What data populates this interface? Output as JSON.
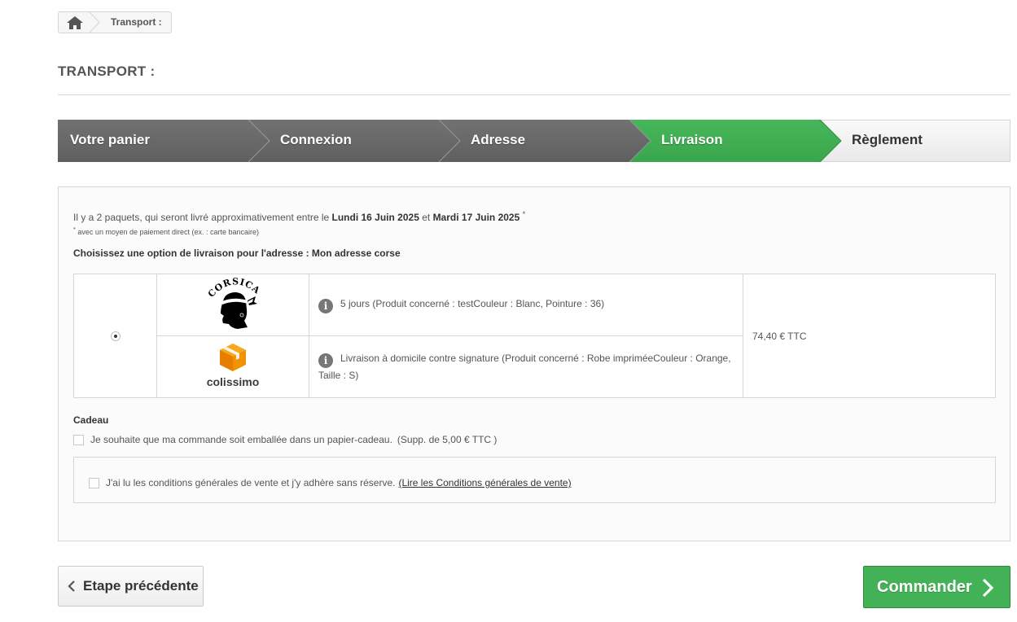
{
  "breadcrumb": {
    "home_icon": "home-icon",
    "current": "Transport :"
  },
  "page": {
    "title": "TRANSPORT :"
  },
  "steps": [
    {
      "label": "Votre panier",
      "state": "done"
    },
    {
      "label": "Connexion",
      "state": "done"
    },
    {
      "label": "Adresse",
      "state": "done"
    },
    {
      "label": "Livraison",
      "state": "current"
    },
    {
      "label": "Règlement",
      "state": "todo"
    }
  ],
  "colors": {
    "step_done": "#666666",
    "step_current": "#43b155",
    "step_todo": "#f4f4f4",
    "accent_green": "#43b155"
  },
  "delivery": {
    "intro": "Il y a 2 paquets, qui seront livré approximativement entre le ",
    "date_start": "Lundi 16 Juin 2025",
    "and": " et ",
    "date_end": "Mardi 17 Juin 2025",
    "asterisk": "*",
    "note_asterisk": "*",
    "note": " avec un moyen de paiement direct (ex. : carte bancaire)",
    "choose_label": "Choisissez une option de livraison pour l'adresse : Mon adresse corse"
  },
  "option": {
    "selected": true,
    "price": "74,40 € TTC",
    "carriers": [
      {
        "logo": "corsica-logo",
        "logo_text": "CORSICA",
        "description": "5 jours (Produit concerné : testCouleur : Blanc, Pointure : 36)"
      },
      {
        "logo": "colissimo-logo",
        "logo_text": "colissimo",
        "description": "Livraison à domicile contre signature (Produit concerné : Robe impriméeCouleur : Orange, Taille : S)"
      }
    ]
  },
  "gift": {
    "title": "Cadeau",
    "label": "Je souhaite que ma commande soit emballée dans un papier-cadeau.",
    "supplement": "(Supp. de 5,00 € TTC )"
  },
  "cgv": {
    "label": "J'ai lu les conditions générales de vente et j'y adhère sans réserve.",
    "link": "(Lire les Conditions générales de vente)"
  },
  "buttons": {
    "previous": "Etape précédente",
    "order": "Commander"
  }
}
